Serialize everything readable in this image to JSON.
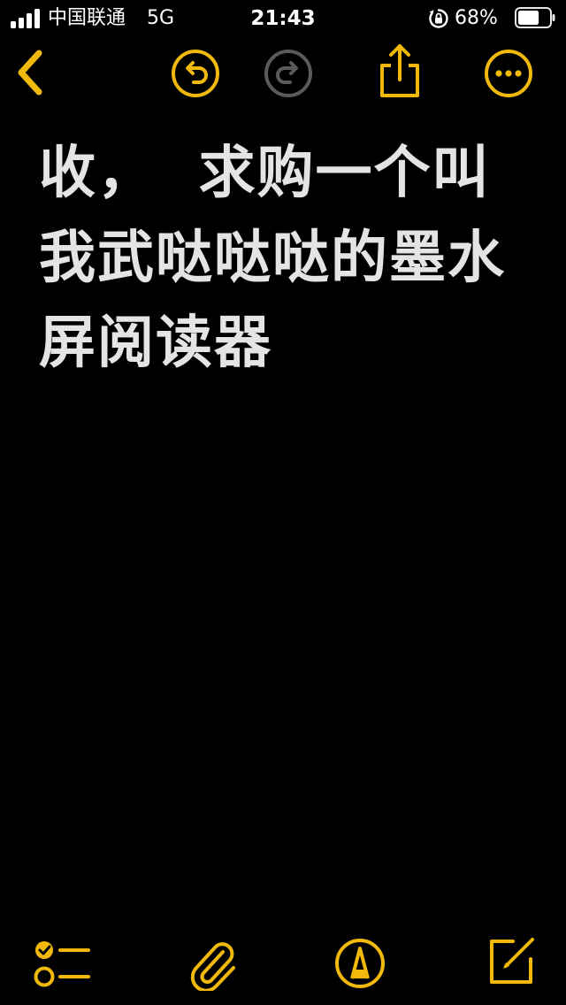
{
  "status_bar": {
    "carrier": "中国联通",
    "network": "5G",
    "time": "21:43",
    "battery_percent": "68%",
    "battery_level": 0.68
  },
  "toolbar": {
    "back_icon": "chevron-left-icon",
    "undo_icon": "undo-icon",
    "redo_icon": "redo-icon",
    "share_icon": "share-icon",
    "more_icon": "ellipsis-circle-icon"
  },
  "note": {
    "text": "收，  求购一个叫我武哒哒哒的墨水屏阅读器"
  },
  "bottom_bar": {
    "checklist_icon": "checklist-icon",
    "attach_icon": "paperclip-icon",
    "markup_icon": "markup-pen-icon",
    "compose_icon": "compose-icon"
  },
  "colors": {
    "accent": "#f0b90b",
    "disabled": "#5a5a5a",
    "text": "#e4e4e4",
    "background": "#000000"
  }
}
